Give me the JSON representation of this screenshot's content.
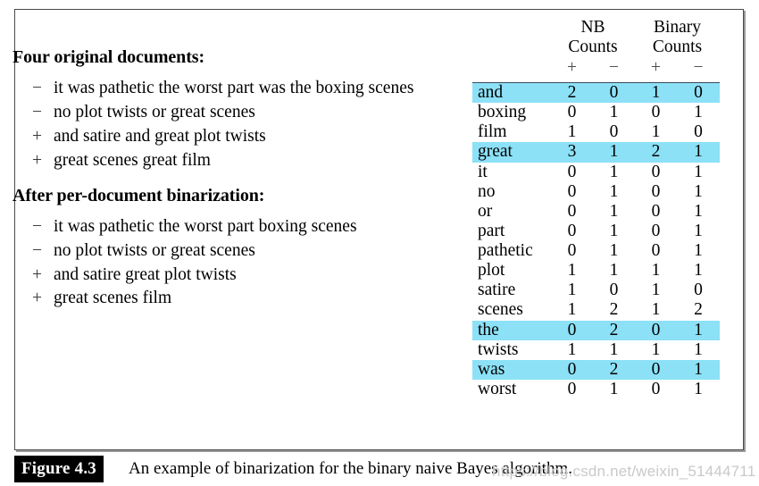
{
  "figure": {
    "tag": "Figure 4.3",
    "caption": "An example of binarization for the binary naive Bayes algorithm."
  },
  "watermark": "https://blog.csdn.net/weixin_51444711",
  "colors": {
    "highlight": "#8ce1f7",
    "rule": "#3c4a5a",
    "frame": "#4a4a4a",
    "sign": "#4d4d4d"
  },
  "left_panel": {
    "sections": [
      {
        "heading": "Four original documents:",
        "items": [
          {
            "sign": "−",
            "line1": "it was pathetic the worst part was the",
            "line2": "boxing scenes"
          },
          {
            "sign": "−",
            "line1": "no plot twists or great scenes",
            "line2": ""
          },
          {
            "sign": "+",
            "line1": "and satire and great plot twists",
            "line2": ""
          },
          {
            "sign": "+",
            "line1": "great scenes great film",
            "line2": ""
          }
        ]
      },
      {
        "heading": "After per-document binarization:",
        "items": [
          {
            "sign": "−",
            "line1": "it was pathetic the worst part boxing",
            "line2": "scenes"
          },
          {
            "sign": "−",
            "line1": "no plot twists or great scenes",
            "line2": ""
          },
          {
            "sign": "+",
            "line1": "and satire great plot twists",
            "line2": ""
          },
          {
            "sign": "+",
            "line1": "great scenes film",
            "line2": ""
          }
        ]
      }
    ]
  },
  "table": {
    "group_headers": [
      {
        "line1": "NB",
        "line2": "Counts"
      },
      {
        "line1": "Binary",
        "line2": "Counts"
      }
    ],
    "sign_headers": [
      "+",
      "−",
      "+",
      "−"
    ],
    "rows": [
      {
        "word": "and",
        "values": [
          "2",
          "0",
          "1",
          "0"
        ],
        "highlight": true
      },
      {
        "word": "boxing",
        "values": [
          "0",
          "1",
          "0",
          "1"
        ],
        "highlight": false
      },
      {
        "word": "film",
        "values": [
          "1",
          "0",
          "1",
          "0"
        ],
        "highlight": false
      },
      {
        "word": "great",
        "values": [
          "3",
          "1",
          "2",
          "1"
        ],
        "highlight": true
      },
      {
        "word": "it",
        "values": [
          "0",
          "1",
          "0",
          "1"
        ],
        "highlight": false
      },
      {
        "word": "no",
        "values": [
          "0",
          "1",
          "0",
          "1"
        ],
        "highlight": false
      },
      {
        "word": "or",
        "values": [
          "0",
          "1",
          "0",
          "1"
        ],
        "highlight": false
      },
      {
        "word": "part",
        "values": [
          "0",
          "1",
          "0",
          "1"
        ],
        "highlight": false
      },
      {
        "word": "pathetic",
        "values": [
          "0",
          "1",
          "0",
          "1"
        ],
        "highlight": false
      },
      {
        "word": "plot",
        "values": [
          "1",
          "1",
          "1",
          "1"
        ],
        "highlight": false
      },
      {
        "word": "satire",
        "values": [
          "1",
          "0",
          "1",
          "0"
        ],
        "highlight": false
      },
      {
        "word": "scenes",
        "values": [
          "1",
          "2",
          "1",
          "2"
        ],
        "highlight": false
      },
      {
        "word": "the",
        "values": [
          "0",
          "2",
          "0",
          "1"
        ],
        "highlight": true
      },
      {
        "word": "twists",
        "values": [
          "1",
          "1",
          "1",
          "1"
        ],
        "highlight": false
      },
      {
        "word": "was",
        "values": [
          "0",
          "2",
          "0",
          "1"
        ],
        "highlight": true
      },
      {
        "word": "worst",
        "values": [
          "0",
          "1",
          "0",
          "1"
        ],
        "highlight": false
      }
    ]
  }
}
